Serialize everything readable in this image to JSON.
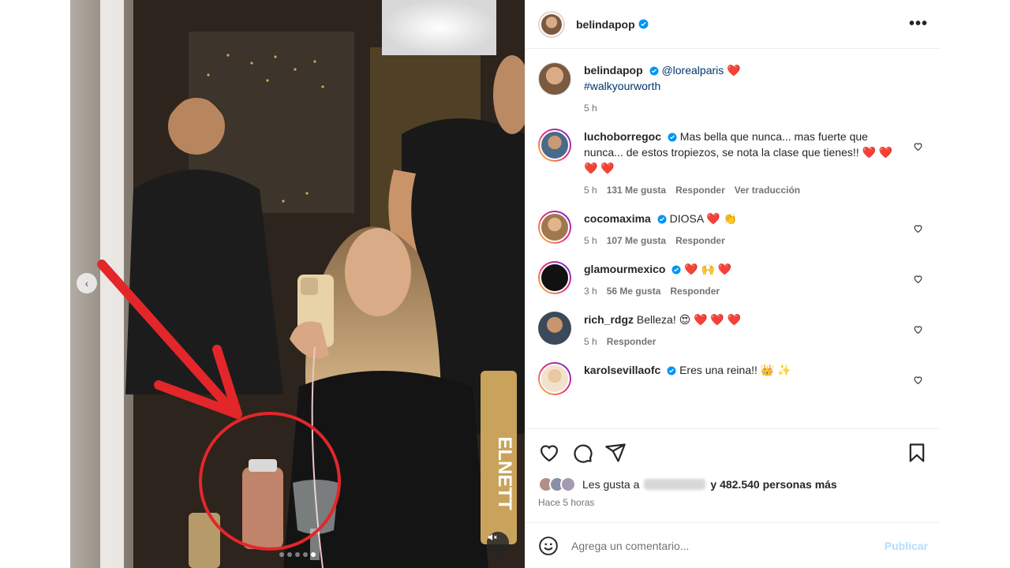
{
  "colors": {
    "accent": "#0095f6",
    "link": "#00376b",
    "verified": "#0095f6",
    "heart": "#e3343b"
  },
  "media": {
    "prev_icon": "chevron-left-icon",
    "mute_icon": "speaker-muted-icon",
    "carousel_dots": 5,
    "active_dot": 4,
    "hairspray_label": "ELNETT"
  },
  "header": {
    "username": "belindapop",
    "more_icon": "more-options-icon",
    "more_label": "•••"
  },
  "caption": {
    "username": "belindapop",
    "mention": "@lorealparis",
    "emoji": "❤️",
    "hashtag": "#walkyourworth",
    "time": "5 h"
  },
  "comments": [
    {
      "username": "luchoborregoc",
      "text": "Mas bella que nunca... mas fuerte que nunca... de estos tropiezos, se nota la clase que tienes!! ❤️ ❤️ ❤️ ❤️",
      "time": "5 h",
      "likes": "131 Me gusta",
      "reply": "Responder",
      "translate": "Ver traducción"
    },
    {
      "username": "cocomaxima",
      "text": "DIOSA ❤️ 👏",
      "time": "5 h",
      "likes": "107 Me gusta",
      "reply": "Responder"
    },
    {
      "username": "glamourmexico",
      "text": "❤️ 🙌 ❤️",
      "time": "3 h",
      "likes": "56 Me gusta",
      "reply": "Responder"
    },
    {
      "username": "rich_rdgz",
      "text": "Belleza! 😍 ❤️ ❤️ ❤️",
      "time": "5 h",
      "reply": "Responder"
    },
    {
      "username": "karolsevillaofc",
      "text": "Eres una reina!! 👑 ✨"
    }
  ],
  "actions": {
    "like_icon": "heart-icon",
    "comment_icon": "comment-icon",
    "share_icon": "share-icon",
    "save_icon": "bookmark-icon",
    "likes_prefix": "Les gusta a",
    "likes_suffix": "y 482.540 personas más",
    "posted": "Hace 5 horas"
  },
  "add_comment": {
    "emoji_icon": "emoji-icon",
    "placeholder": "Agrega un comentario...",
    "publish": "Publicar"
  }
}
